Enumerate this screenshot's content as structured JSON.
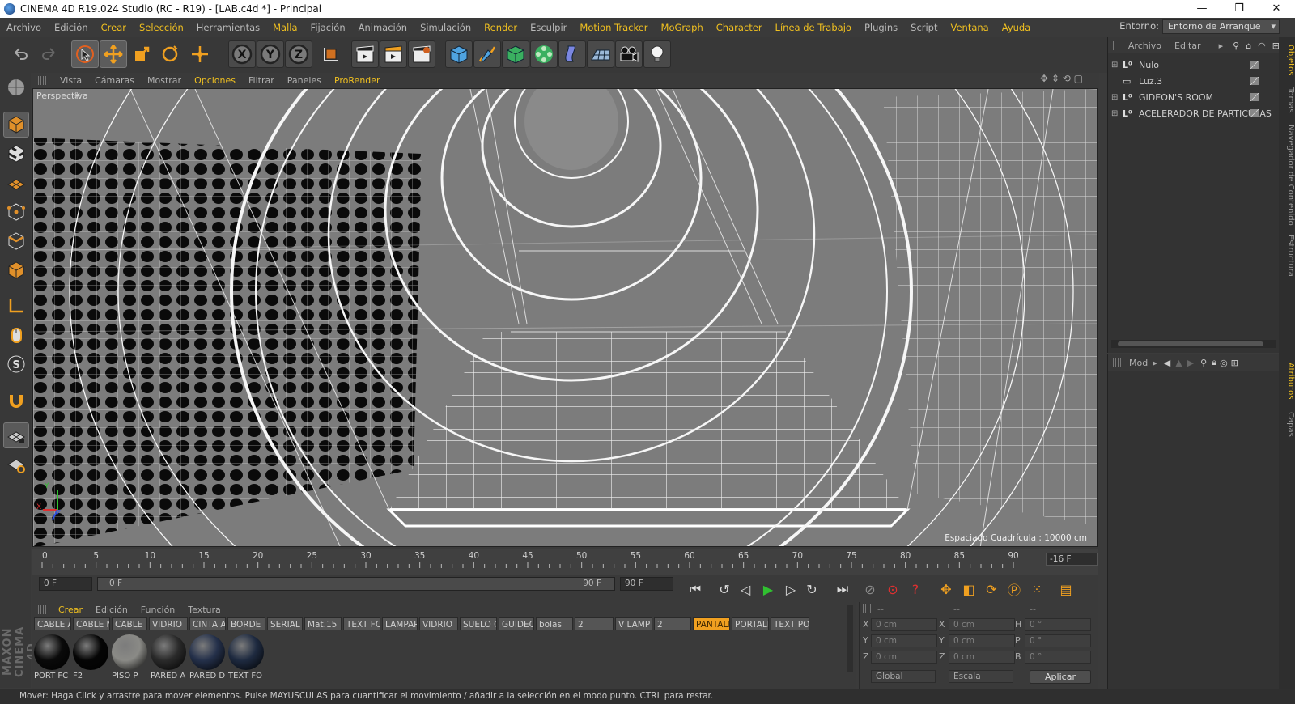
{
  "window": {
    "title": "CINEMA 4D R19.024 Studio (RC - R19) - [LAB.c4d *] - Principal",
    "controls": [
      "—",
      "❐",
      "✕"
    ]
  },
  "menu": [
    {
      "label": "Archivo",
      "hl": false
    },
    {
      "label": "Edición",
      "hl": false
    },
    {
      "label": "Crear",
      "hl": true
    },
    {
      "label": "Selección",
      "hl": true
    },
    {
      "label": "Herramientas",
      "hl": false
    },
    {
      "label": "Malla",
      "hl": true
    },
    {
      "label": "Fijación",
      "hl": false
    },
    {
      "label": "Animación",
      "hl": false
    },
    {
      "label": "Simulación",
      "hl": false
    },
    {
      "label": "Render",
      "hl": true
    },
    {
      "label": "Esculpir",
      "hl": false
    },
    {
      "label": "Motion Tracker",
      "hl": true
    },
    {
      "label": "MoGraph",
      "hl": true
    },
    {
      "label": "Character",
      "hl": true
    },
    {
      "label": "Línea de Trabajo",
      "hl": true
    },
    {
      "label": "Plugins",
      "hl": false
    },
    {
      "label": "Script",
      "hl": false
    },
    {
      "label": "Ventana",
      "hl": true
    },
    {
      "label": "Ayuda",
      "hl": true
    }
  ],
  "environment": {
    "label": "Entorno:",
    "value": "Entorno de Arranque"
  },
  "viewport": {
    "menu": [
      {
        "label": "Vista",
        "hl": false
      },
      {
        "label": "Cámaras",
        "hl": false
      },
      {
        "label": "Mostrar",
        "hl": false
      },
      {
        "label": "Opciones",
        "hl": true
      },
      {
        "label": "Filtrar",
        "hl": false
      },
      {
        "label": "Paneles",
        "hl": false
      },
      {
        "label": "ProRender",
        "hl": true
      }
    ],
    "camera_label": "Perspectiva",
    "grid_spacing": "Espaciado Cuadrícula : 10000 cm",
    "axis_labels": {
      "x": "X",
      "y": "Y",
      "z": "Z"
    }
  },
  "timeline": {
    "ticks": [
      "0",
      "5",
      "10",
      "15",
      "20",
      "25",
      "30",
      "35",
      "40",
      "45",
      "50",
      "55",
      "60",
      "65",
      "70",
      "75",
      "80",
      "85",
      "90"
    ],
    "current_frame": "-16 F",
    "start_field": "0 F",
    "range_start": "0 F",
    "range_end": "90 F",
    "end_field": "90 F"
  },
  "materials": {
    "menu": [
      {
        "label": "Crear",
        "hl": true
      },
      {
        "label": "Edición",
        "hl": false
      },
      {
        "label": "Función",
        "hl": false
      },
      {
        "label": "Textura",
        "hl": false
      }
    ],
    "tags": [
      {
        "label": "CABLE A",
        "hl": false
      },
      {
        "label": "CABLE N",
        "hl": false
      },
      {
        "label": "CABLE c",
        "hl": false
      },
      {
        "label": "VIDRIO",
        "hl": false
      },
      {
        "label": "CINTA A",
        "hl": false
      },
      {
        "label": "BORDE",
        "hl": false
      },
      {
        "label": "SERIAL",
        "hl": false
      },
      {
        "label": "Mat.15",
        "hl": false
      },
      {
        "label": "TEXT FO",
        "hl": false
      },
      {
        "label": "LAMPAR",
        "hl": false
      },
      {
        "label": "VIDRIO",
        "hl": false
      },
      {
        "label": "SUELO C",
        "hl": false
      },
      {
        "label": "GUIDEO",
        "hl": false
      },
      {
        "label": "bolas",
        "hl": false
      },
      {
        "label": "2",
        "hl": false
      },
      {
        "label": "V LAMP",
        "hl": false
      },
      {
        "label": "2",
        "hl": false
      },
      {
        "label": "PANTALL",
        "hl": true
      },
      {
        "label": "PORTALL",
        "hl": false
      },
      {
        "label": "TEXT PO",
        "hl": false
      }
    ],
    "balls": [
      {
        "label": "PORT FC",
        "color": "#0a0a0a"
      },
      {
        "label": "F2",
        "color": "#050505"
      },
      {
        "label": "PISO P",
        "color": "#8a8a86"
      },
      {
        "label": "PARED A",
        "color": "#2a2a2a"
      },
      {
        "label": "PARED D",
        "color": "#24304a"
      },
      {
        "label": "TEXT FO",
        "color": "#1e2a40"
      }
    ]
  },
  "coordinates": {
    "headers": [
      "--",
      "--",
      "--"
    ],
    "rows": [
      {
        "a": "X",
        "av": "0 cm",
        "b": "X",
        "bv": "0 cm",
        "c": "H",
        "cv": "0 °"
      },
      {
        "a": "Y",
        "av": "0 cm",
        "b": "Y",
        "bv": "0 cm",
        "c": "P",
        "cv": "0 °"
      },
      {
        "a": "Z",
        "av": "0 cm",
        "b": "Z",
        "bv": "0 cm",
        "c": "B",
        "cv": "0 °"
      }
    ],
    "mode1": "Global",
    "mode2": "Escala",
    "apply": "Aplicar"
  },
  "objects": {
    "menu": [
      "Archivo",
      "Editar"
    ],
    "items": [
      {
        "label": "Nulo",
        "type": "null"
      },
      {
        "label": "Luz.3",
        "type": "light"
      },
      {
        "label": "GIDEON'S ROOM",
        "type": "null"
      },
      {
        "label": "ACELERADOR DE PARTICULAS",
        "type": "null"
      }
    ]
  },
  "attributes": {
    "mode_label": "Mod"
  },
  "right_tabs": {
    "top": [
      {
        "label": "Objetos",
        "hl": true
      },
      {
        "label": "Tomas",
        "hl": false
      },
      {
        "label": "Navegador de Contenido",
        "hl": false
      },
      {
        "label": "Estructura",
        "hl": false
      }
    ],
    "bottom": [
      {
        "label": "Atributos",
        "hl": true
      },
      {
        "label": "Capas",
        "hl": false
      }
    ]
  },
  "status": "Mover: Haga Click y arrastre para mover elementos. Pulse MAYUSCULAS para cuantificar el movimiento / añadir a la selección en el modo punto. CTRL para restar."
}
